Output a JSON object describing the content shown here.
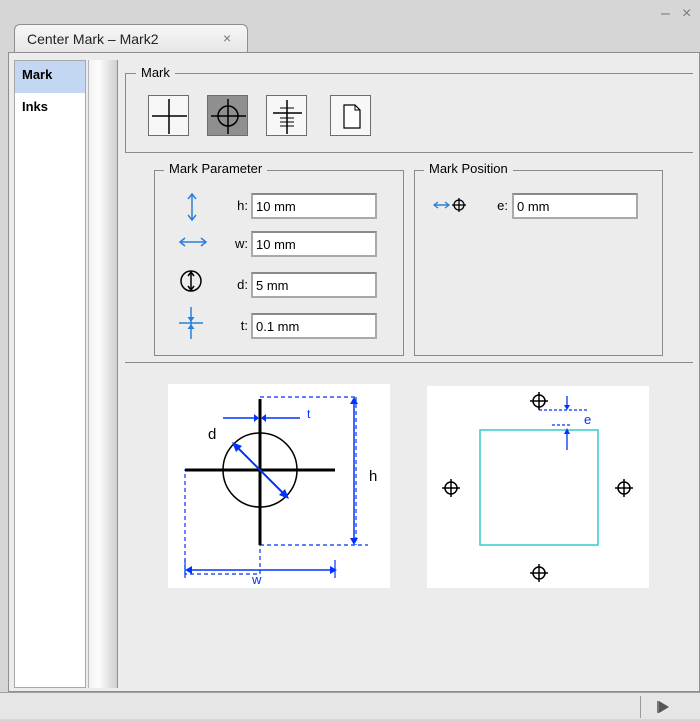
{
  "window": {
    "minimize_glyph": "–",
    "close_glyph": "×",
    "tab_title": "Center Mark – Mark2",
    "tab_close_glyph": "×"
  },
  "sidebar": {
    "items": [
      {
        "label": "Mark",
        "selected": true
      },
      {
        "label": "Inks",
        "selected": false
      }
    ]
  },
  "mark_group": {
    "title": "Mark",
    "tools": [
      {
        "icon": "crosshair-icon",
        "active": false
      },
      {
        "icon": "circle-crosshair-icon",
        "active": true
      },
      {
        "icon": "crosshair-ladder-icon",
        "active": false
      },
      {
        "icon": "blank-page-icon",
        "active": false
      }
    ]
  },
  "mark_parameter": {
    "title": "Mark Parameter",
    "fields": [
      {
        "icon": "vertical-arrow-icon",
        "label": "h:",
        "value": "10 mm"
      },
      {
        "icon": "horizontal-arrow-icon",
        "label": "w:",
        "value": "10 mm"
      },
      {
        "icon": "circle-diameter-icon",
        "label": "d:",
        "value": "5 mm"
      },
      {
        "icon": "thickness-icon",
        "label": "t:",
        "value": "0.1 mm"
      }
    ]
  },
  "mark_position": {
    "title": "Mark Position",
    "fields": [
      {
        "icon": "offset-mark-icon",
        "label": "e:",
        "value": "0 mm"
      }
    ]
  },
  "diagrams": {
    "left_labels": {
      "d": "d",
      "t": "t",
      "h": "h",
      "w": "w"
    },
    "right_labels": {
      "e": "e"
    }
  },
  "bottom_bar": {
    "play_icon": "play-arrow-icon"
  },
  "colors": {
    "accent_blue": "#0033ff",
    "icon_blue": "#2a7fd8",
    "page_cyan": "#33cccc",
    "selection": "#c3d7f2"
  }
}
